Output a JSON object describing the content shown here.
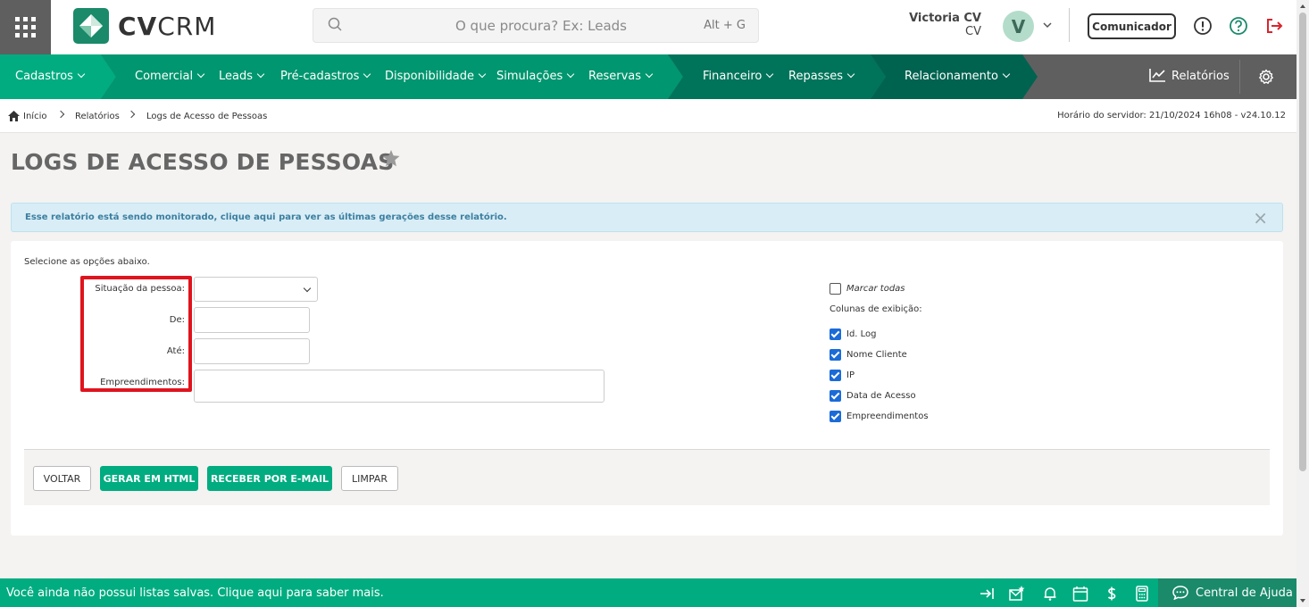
{
  "header": {
    "logo_bold": "CV",
    "logo_light": "CRM",
    "search_placeholder": "O que procura? Ex: Leads",
    "search_shortcut": "Alt + G",
    "user_name": "Victoria CV",
    "user_sub": "CV",
    "avatar_letter": "V",
    "comunicador_label": "Comunicador"
  },
  "nav": {
    "items": [
      {
        "label": "Cadastros"
      },
      {
        "label": "Comercial"
      },
      {
        "label": "Leads"
      },
      {
        "label": "Pré-cadastros"
      },
      {
        "label": "Disponibilidade"
      },
      {
        "label": "Simulações"
      },
      {
        "label": "Reservas"
      },
      {
        "label": "Financeiro"
      },
      {
        "label": "Repasses"
      },
      {
        "label": "Relacionamento"
      }
    ],
    "reports_label": "Relatórios",
    "colors": {
      "green_bright": "#00ac80",
      "green_mid": "#00966f",
      "green_dark": "#00745a",
      "gray": "#5f5f5f"
    }
  },
  "breadcrumb": {
    "home": "Início",
    "level1": "Relatórios",
    "level2": "Logs de Acesso de Pessoas",
    "server_time": "Horário do servidor: 21/10/2024 16h08 - v24.10.12"
  },
  "page": {
    "title": "LOGS DE ACESSO DE PESSOAS",
    "alert": "Esse relatório está sendo monitorado, clique aqui para ver as últimas gerações desse relatório.",
    "alert_close": "×",
    "intro": "Selecione as opções abaixo."
  },
  "form": {
    "situacao_label": "Situação da pessoa:",
    "de_label": "De:",
    "ate_label": "Até:",
    "empreendimentos_label": "Empreendimentos:",
    "situacao_value": "",
    "de_value": "",
    "ate_value": "",
    "empreendimentos_value": ""
  },
  "columns": {
    "marcar_todas": "Marcar todas",
    "heading": "Colunas de exibição:",
    "items": [
      {
        "label": "Id. Log"
      },
      {
        "label": "Nome Cliente"
      },
      {
        "label": "IP"
      },
      {
        "label": "Data de Acesso"
      },
      {
        "label": "Empreendimentos"
      }
    ]
  },
  "actions": {
    "voltar": "VOLTAR",
    "gerar_html": "GERAR EM HTML",
    "receber_email": "RECEBER POR E-MAIL",
    "limpar": "LIMPAR"
  },
  "footer": {
    "message": "Você ainda não possui listas salvas. Clique aqui para saber mais.",
    "help_label": "Central de Ajuda"
  }
}
